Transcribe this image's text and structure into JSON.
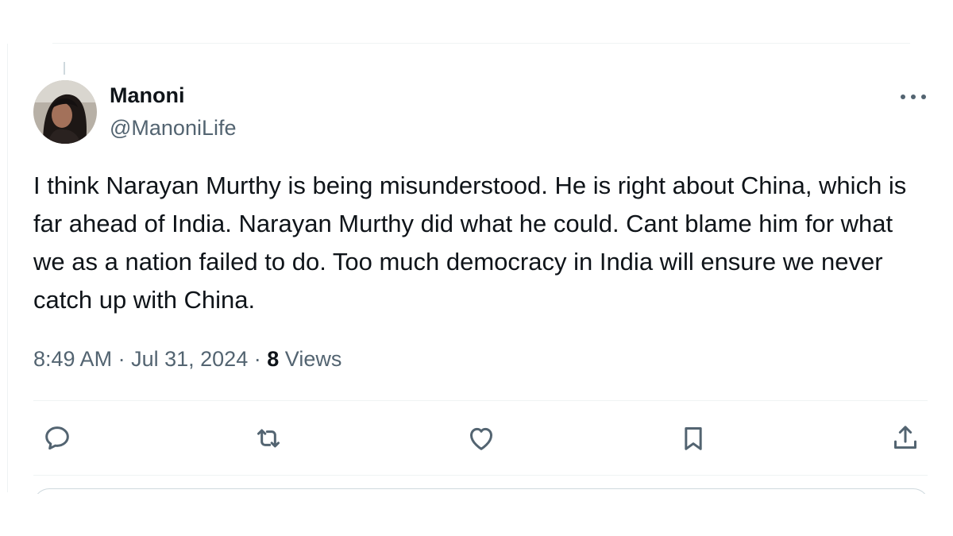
{
  "author": {
    "display_name": "Manoni",
    "handle": "@ManoniLife"
  },
  "tweet": {
    "text": "I think Narayan Murthy is being misunderstood. He is right about China, which is far ahead of India. Narayan Murthy did what he could. Cant blame him for what we as a nation failed to do. Too much democracy in India will ensure we never catch up with China.",
    "time": "8:49 AM",
    "separator": "·",
    "date": "Jul 31, 2024",
    "views_count": "8",
    "views_label": "Views"
  },
  "icons": {
    "more": "more-horizontal-icon",
    "reply": "reply-icon",
    "retweet": "retweet-icon",
    "like": "heart-icon",
    "bookmark": "bookmark-icon",
    "share": "share-icon"
  },
  "colors": {
    "text_primary": "#0f1419",
    "text_secondary": "#536471",
    "divider": "#eff3f4"
  }
}
